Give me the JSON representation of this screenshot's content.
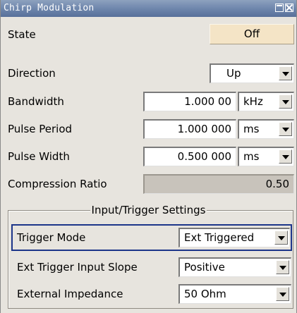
{
  "window": {
    "title": "Chirp Modulation",
    "maximize_icon": "maximize-icon",
    "close_icon": "close-icon"
  },
  "state": {
    "label": "State",
    "value": "Off"
  },
  "direction": {
    "label": "Direction",
    "value": "Up"
  },
  "bandwidth": {
    "label": "Bandwidth",
    "value": "1.000 00",
    "unit": "kHz"
  },
  "pulse_period": {
    "label": "Pulse Period",
    "value": "1.000 000",
    "unit": "ms"
  },
  "pulse_width": {
    "label": "Pulse Width",
    "value": "0.500 000",
    "unit": "ms"
  },
  "compression_ratio": {
    "label": "Compression Ratio",
    "value": "0.50"
  },
  "trigger_settings": {
    "title": "Input/Trigger Settings",
    "trigger_mode": {
      "label": "Trigger Mode",
      "value": "Ext Triggered"
    },
    "ext_trigger_slope": {
      "label": "Ext Trigger Input Slope",
      "value": "Positive"
    },
    "external_impedance": {
      "label": "External Impedance",
      "value": "50 Ohm"
    }
  },
  "colors": {
    "title_bar": "#6c84ab",
    "state_button": "#f4e4c6",
    "focus_border": "#1c3589",
    "background": "#e7e4de"
  }
}
